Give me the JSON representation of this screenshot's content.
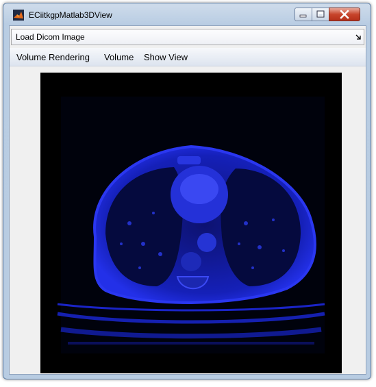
{
  "window": {
    "title": "ECiitkgpMatlab3DView"
  },
  "icons": {
    "app": "matlab-icon",
    "minimize": "minimize-icon",
    "maximize": "maximize-icon",
    "close": "close-icon",
    "panel_toggle": "arrow-icon"
  },
  "panel": {
    "label": "Load Dicom Image"
  },
  "menu": {
    "items": [
      "Volume Rendering",
      "Volume",
      "Show View"
    ]
  },
  "viewer": {
    "content": "axial chest CT slice rendered in blue colormap"
  },
  "colors": {
    "scan_tint": "#1a22d6",
    "viewer_background": "#000000",
    "close_button": "#c7442b"
  }
}
